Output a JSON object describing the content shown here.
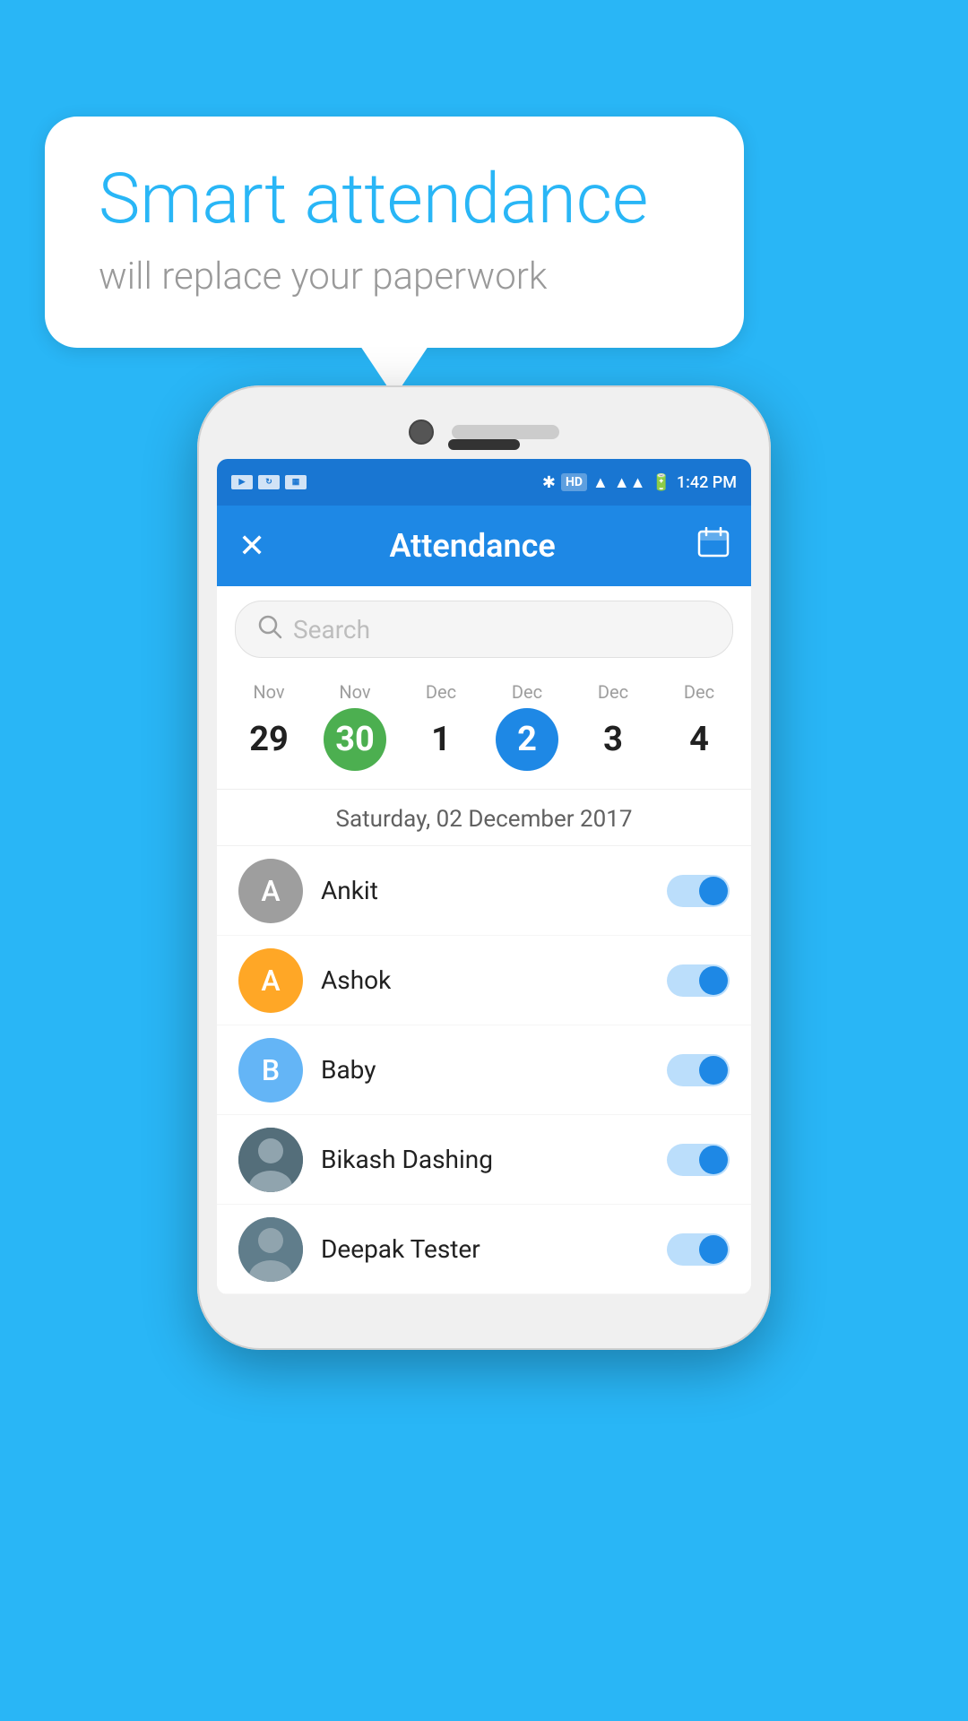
{
  "bubble": {
    "title": "Smart attendance",
    "subtitle": "will replace your paperwork"
  },
  "status_bar": {
    "time": "1:42 PM",
    "icons": [
      "▶",
      "↻",
      "🖼"
    ],
    "right_icons": "✱ HD ▲▲ 🔋"
  },
  "app_bar": {
    "close_label": "✕",
    "title": "Attendance",
    "calendar_label": "📅"
  },
  "search": {
    "placeholder": "Search"
  },
  "calendar": {
    "days": [
      {
        "month": "Nov",
        "num": "29",
        "style": "plain"
      },
      {
        "month": "Nov",
        "num": "30",
        "style": "green"
      },
      {
        "month": "Dec",
        "num": "1",
        "style": "plain"
      },
      {
        "month": "Dec",
        "num": "2",
        "style": "blue"
      },
      {
        "month": "Dec",
        "num": "3",
        "style": "plain"
      },
      {
        "month": "Dec",
        "num": "4",
        "style": "plain"
      }
    ],
    "selected_date": "Saturday, 02 December 2017"
  },
  "attendance": {
    "items": [
      {
        "id": 1,
        "name": "Ankit",
        "avatar_letter": "A",
        "avatar_style": "gray",
        "toggle": true
      },
      {
        "id": 2,
        "name": "Ashok",
        "avatar_letter": "A",
        "avatar_style": "orange",
        "toggle": true
      },
      {
        "id": 3,
        "name": "Baby",
        "avatar_letter": "B",
        "avatar_style": "lightblue",
        "toggle": true
      },
      {
        "id": 4,
        "name": "Bikash Dashing",
        "avatar_letter": null,
        "avatar_style": "photo",
        "toggle": true
      },
      {
        "id": 5,
        "name": "Deepak Tester",
        "avatar_letter": null,
        "avatar_style": "photo2",
        "toggle": true
      }
    ]
  }
}
